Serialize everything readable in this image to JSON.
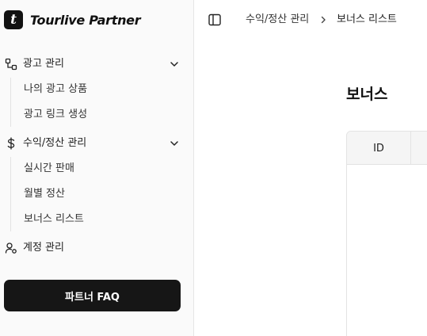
{
  "brand": {
    "logo_letter": "t",
    "name": "Tourlive Partner"
  },
  "sidebar": {
    "groups": [
      {
        "label": "광고 관리",
        "icon": "ads-icon",
        "expanded": true,
        "items": [
          {
            "label": "나의 광고 상품"
          },
          {
            "label": "광고 링크 생성"
          }
        ]
      },
      {
        "label": "수익/정산 관리",
        "icon": "dollar-icon",
        "expanded": true,
        "items": [
          {
            "label": "실시간 판매"
          },
          {
            "label": "월별 정산"
          },
          {
            "label": "보너스 리스트"
          }
        ]
      },
      {
        "label": "계정 관리",
        "icon": "user-settings-icon",
        "expanded": false,
        "items": []
      }
    ],
    "faq_button": "파트너 FAQ"
  },
  "breadcrumb": {
    "parent": "수익/정산 관리",
    "current": "보너스 리스트"
  },
  "main": {
    "title": "보너스",
    "table": {
      "columns": [
        "ID"
      ]
    }
  }
}
